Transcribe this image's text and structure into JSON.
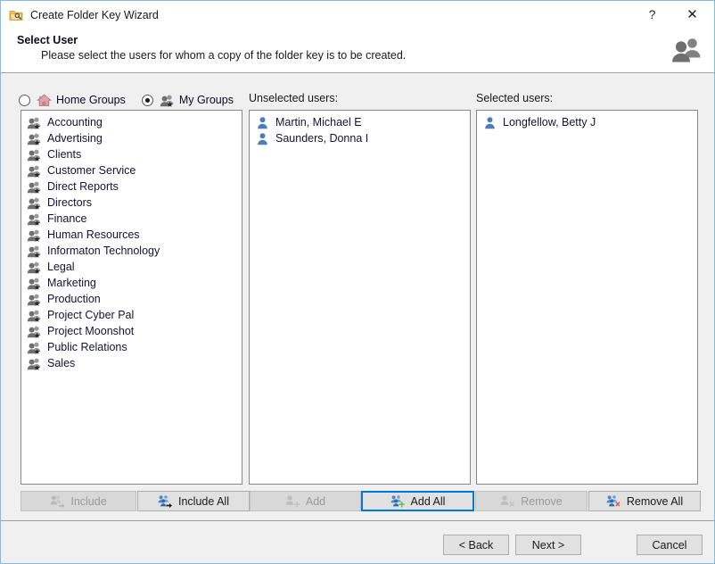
{
  "window": {
    "title": "Create Folder Key Wizard",
    "icon": "folder-key-icon",
    "help_label": "?",
    "close_label": "✕",
    "border_color": "#7fbcec"
  },
  "header": {
    "title": "Select User",
    "subtitle": "Please select the users for whom a copy of the folder key is to be created.",
    "icon": "users-icon"
  },
  "scope": {
    "options": [
      {
        "label": "Home Groups",
        "icon": "home-group-icon",
        "selected": false
      },
      {
        "label": "My Groups",
        "icon": "my-group-icon",
        "selected": true
      }
    ]
  },
  "columns": {
    "groups_label": "",
    "unselected_label": "Unselected users:",
    "selected_label": "Selected users:"
  },
  "groups": {
    "icon": "group-star-icon",
    "items": [
      "Accounting",
      "Advertising",
      "Clients",
      "Customer Service",
      "Direct Reports",
      "Directors",
      "Finance",
      "Human Resources",
      "Informaton Technology",
      "Legal",
      "Marketing",
      "Production",
      "Project Cyber Pal",
      "Project Moonshot",
      "Public Relations",
      "Sales"
    ]
  },
  "unselected_users": {
    "icon": "person-icon",
    "items": [
      "Martin, Michael E",
      "Saunders, Donna I"
    ]
  },
  "selected_users": {
    "icon": "person-icon",
    "items": [
      "Longfellow, Betty J"
    ]
  },
  "actions": {
    "include": {
      "label": "Include",
      "icon": "include-icon",
      "enabled": false,
      "focused": false
    },
    "include_all": {
      "label": "Include All",
      "icon": "include-all-icon",
      "enabled": true,
      "focused": false
    },
    "add": {
      "label": "Add",
      "icon": "add-icon",
      "enabled": false,
      "focused": false
    },
    "add_all": {
      "label": "Add All",
      "icon": "add-all-icon",
      "enabled": true,
      "focused": true
    },
    "remove": {
      "label": "Remove",
      "icon": "remove-icon",
      "enabled": false,
      "focused": false
    },
    "remove_all": {
      "label": "Remove All",
      "icon": "remove-all-icon",
      "enabled": true,
      "focused": false
    }
  },
  "footer": {
    "back": "< Back",
    "next": "Next >",
    "cancel": "Cancel"
  },
  "colors": {
    "accent": "#0078d7",
    "person_blue": "#4a7ebb",
    "group_gray": "#7a7a7a",
    "window_bg": "#f0f0f0"
  }
}
